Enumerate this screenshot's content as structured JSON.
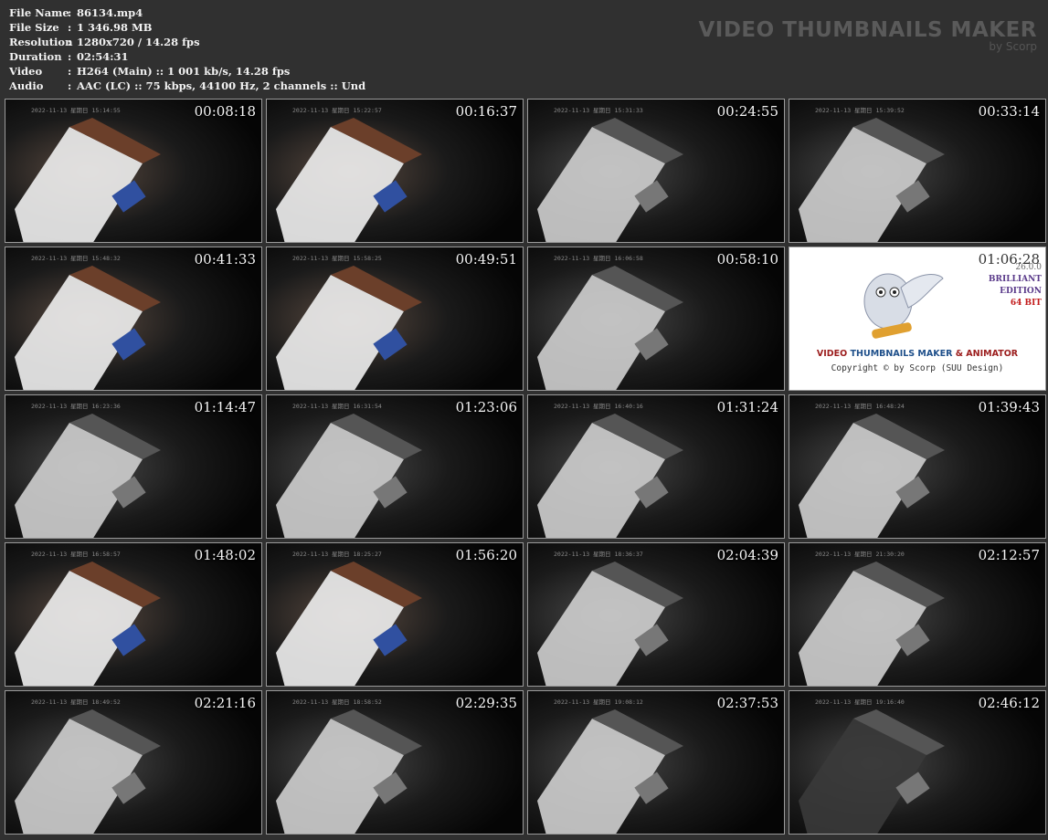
{
  "info": {
    "rows": [
      {
        "key": "File Name",
        "value": "86134.mp4"
      },
      {
        "key": "File Size",
        "value": "1 346.98 MB"
      },
      {
        "key": "Resolution",
        "value": "1280x720 / 14.28 fps"
      },
      {
        "key": "Duration",
        "value": "02:54:31"
      },
      {
        "key": "Video",
        "value": "H264 (Main) :: 1 001 kb/s, 14.28 fps"
      },
      {
        "key": "Audio",
        "value": "AAC (LC) :: 75 kbps, 44100 Hz, 2 channels :: Und"
      }
    ]
  },
  "brand": {
    "title": "VIDEO THUMBNAILS MAKER",
    "subtitle": "by Scorp"
  },
  "thumbnails": [
    {
      "time": "00:08:18",
      "stamp": "2022-11-13 星期日 15:14:55"
    },
    {
      "time": "00:16:37",
      "stamp": "2022-11-13 星期日 15:22:57"
    },
    {
      "time": "00:24:55",
      "stamp": "2022-11-13 星期日 15:31:33"
    },
    {
      "time": "00:33:14",
      "stamp": "2022-11-13 星期日 15:39:52"
    },
    {
      "time": "00:41:33",
      "stamp": "2022-11-13 星期日 15:48:32"
    },
    {
      "time": "00:49:51",
      "stamp": "2022-11-13 星期日 15:58:25"
    },
    {
      "time": "00:58:10",
      "stamp": "2022-11-13 星期日 16:06:58"
    },
    {
      "time": "01:06:28",
      "stamp": ""
    },
    {
      "time": "01:14:47",
      "stamp": "2022-11-13 星期日 16:23:36"
    },
    {
      "time": "01:23:06",
      "stamp": "2022-11-13 星期日 16:31:54"
    },
    {
      "time": "01:31:24",
      "stamp": "2022-11-13 星期日 16:40:16"
    },
    {
      "time": "01:39:43",
      "stamp": "2022-11-13 星期日 16:48:24"
    },
    {
      "time": "01:48:02",
      "stamp": "2022-11-13 星期日 16:58:57"
    },
    {
      "time": "01:56:20",
      "stamp": "2022-11-13 星期日 18:25:27"
    },
    {
      "time": "02:04:39",
      "stamp": "2022-11-13 星期日 18:36:37"
    },
    {
      "time": "02:12:57",
      "stamp": "2022-11-13 星期日 21:30:20"
    },
    {
      "time": "02:21:16",
      "stamp": "2022-11-13 星期日 18:49:52"
    },
    {
      "time": "02:29:35",
      "stamp": "2022-11-13 星期日 18:58:52"
    },
    {
      "time": "02:37:53",
      "stamp": "2022-11-13 星期日 19:08:12"
    },
    {
      "time": "02:46:12",
      "stamp": "2022-11-13 星期日 19:16:40"
    }
  ],
  "logo_tile": {
    "index": 7,
    "version": "26.0.0",
    "edition_line1": "BRILLIANT",
    "edition_line2": "EDITION",
    "bits": "64 BIT",
    "line1_a": "VIDEO ",
    "line1_b": "THUMBNAILS MAKER",
    "line1_c": " & ANIMATOR",
    "copyright": "Copyright © by Scorp (SUU Design)"
  },
  "colors": {
    "background": "#303030",
    "text": "#f2f2f2",
    "brand": "#5a5a5a"
  }
}
